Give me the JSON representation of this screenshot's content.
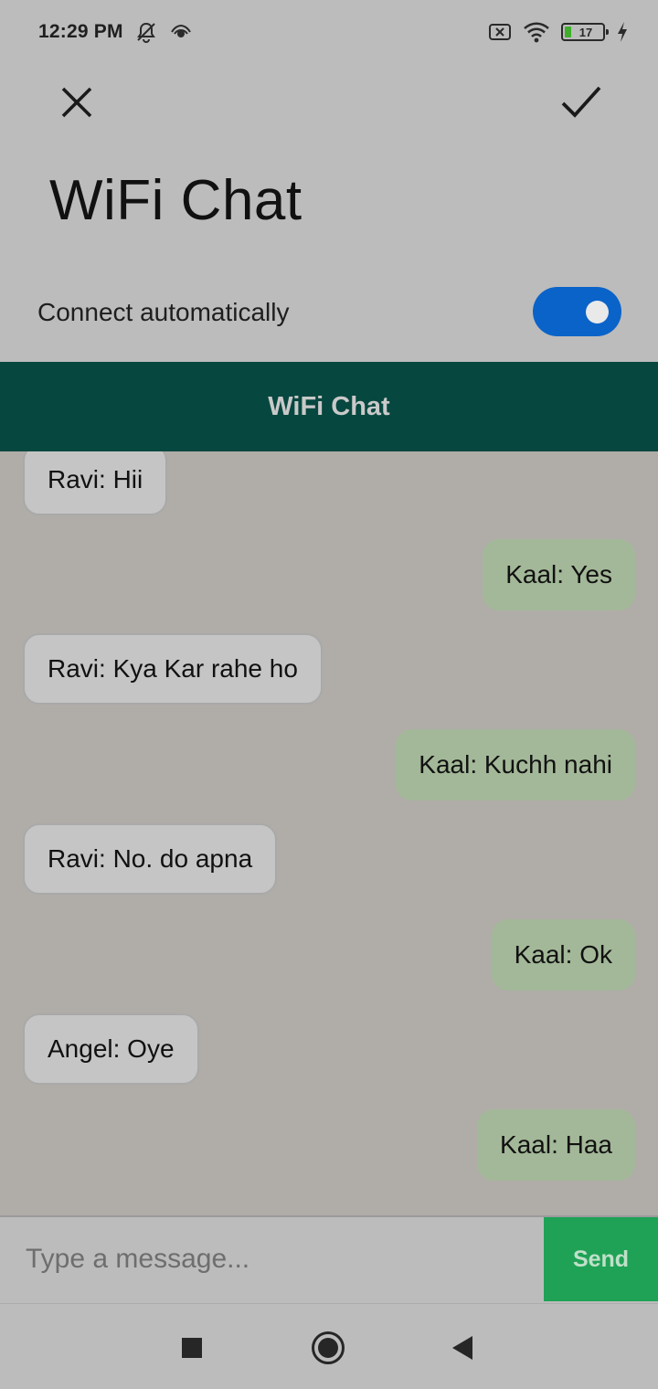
{
  "status_bar": {
    "time": "12:29 PM",
    "battery_level": "17",
    "icons_left": [
      "mute-notifications-icon",
      "hotspot-eye-icon"
    ],
    "icons_right": [
      "sim-missing-icon",
      "wifi-icon",
      "battery-icon",
      "charging-bolt-icon"
    ]
  },
  "dialog": {
    "title": "WiFi Chat",
    "toggle_label": "Connect automatically",
    "toggle_on": true,
    "accent_color": "#0a63c9"
  },
  "app_bar": {
    "title": "WiFi Chat",
    "color": "#06473f"
  },
  "messages": [
    {
      "text": "Ravi: Hii",
      "side": "left"
    },
    {
      "text": "Kaal: Yes",
      "side": "right"
    },
    {
      "text": "Ravi: Kya Kar rahe ho",
      "side": "left"
    },
    {
      "text": "Kaal: Kuchh nahi",
      "side": "right"
    },
    {
      "text": "Ravi: No. do apna",
      "side": "left"
    },
    {
      "text": "Kaal: Ok",
      "side": "right"
    },
    {
      "text": "Angel: Oye",
      "side": "left"
    },
    {
      "text": "Kaal: Haa",
      "side": "right"
    }
  ],
  "composer": {
    "placeholder": "Type a message...",
    "value": "",
    "send_label": "Send",
    "send_color": "#1fa256"
  },
  "nav_bar": {
    "buttons": [
      "recents-square-icon",
      "home-circle-icon",
      "back-triangle-icon"
    ]
  }
}
